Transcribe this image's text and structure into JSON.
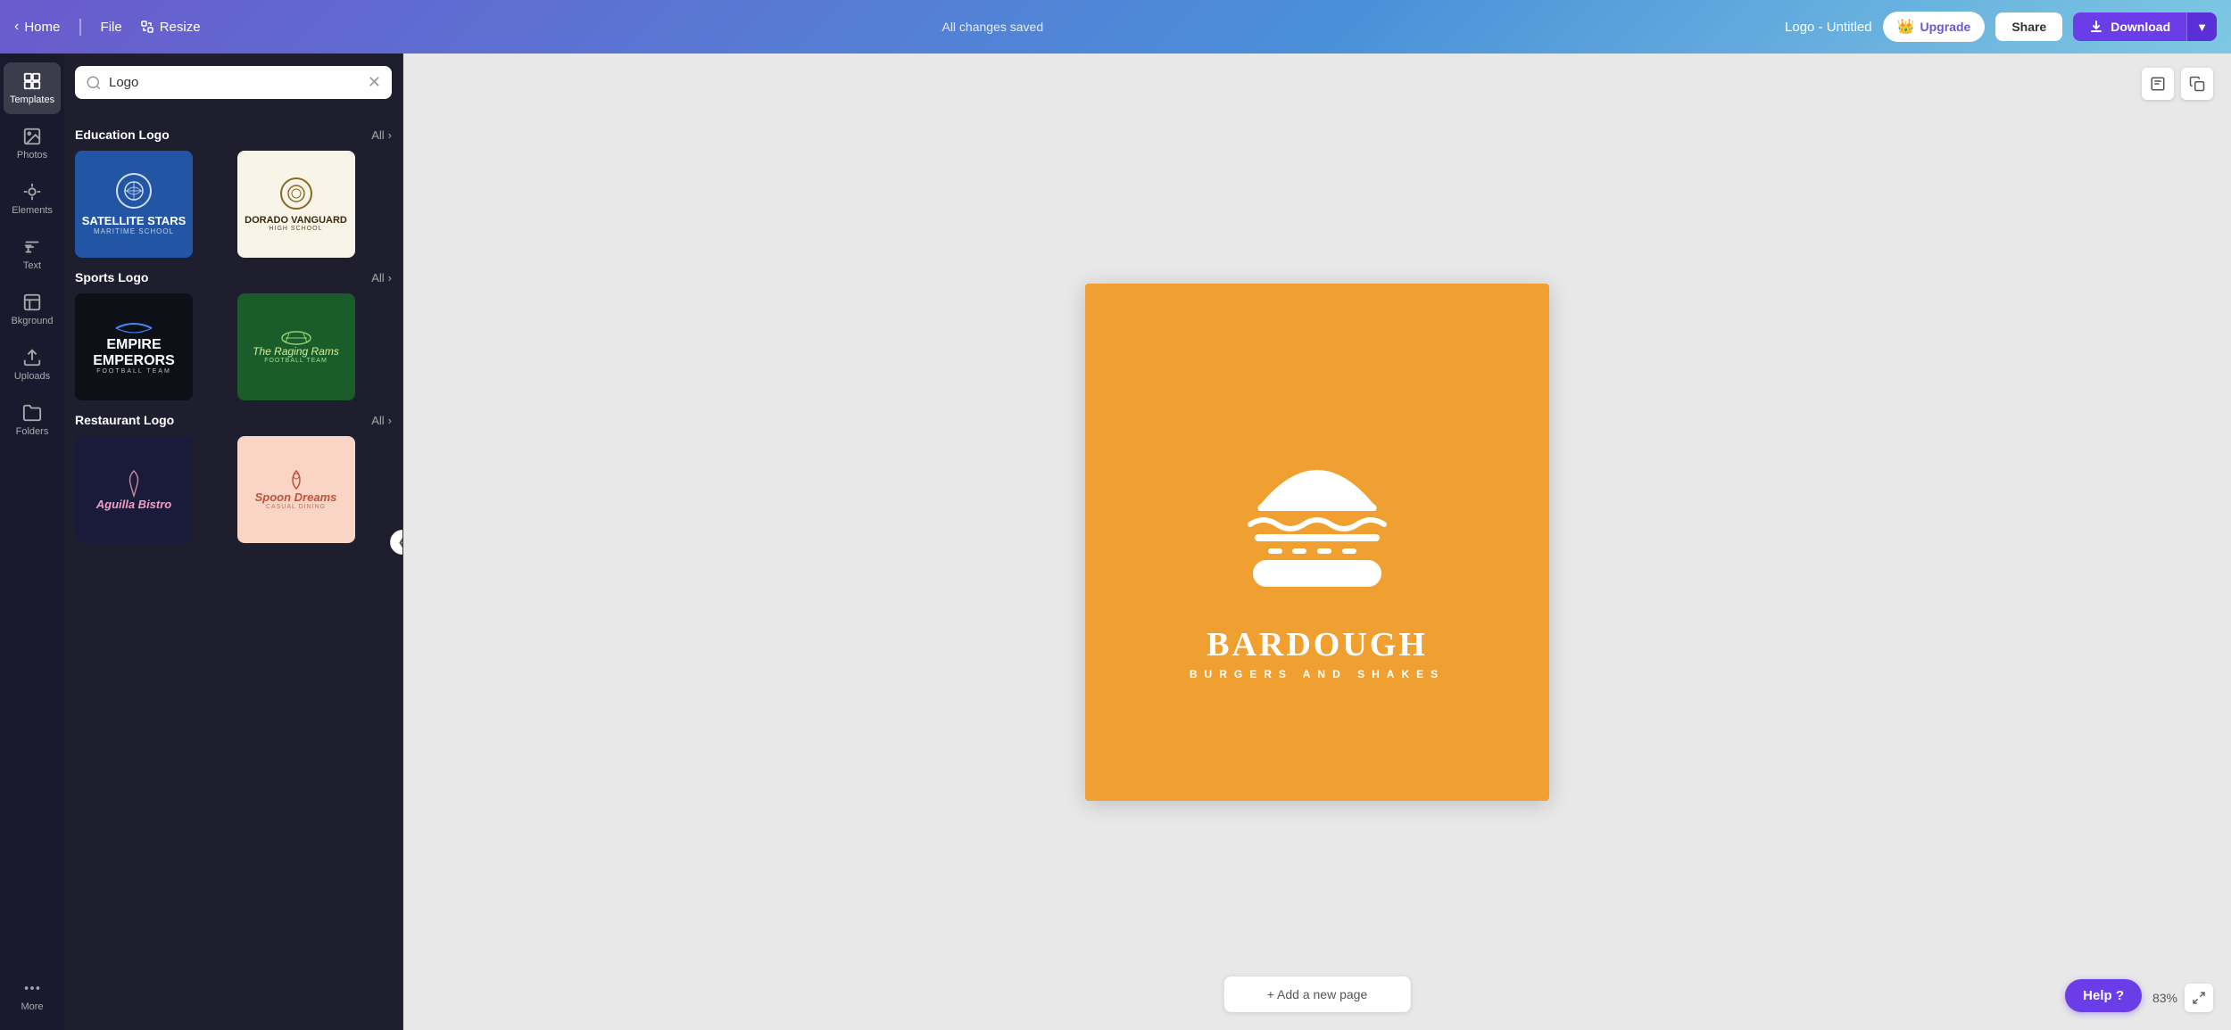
{
  "topbar": {
    "home_label": "Home",
    "file_label": "File",
    "resize_label": "Resize",
    "autosave_label": "All changes saved",
    "logo_title": "Logo - Untitled",
    "upgrade_label": "Upgrade",
    "share_label": "Share",
    "download_label": "Download"
  },
  "sidebar": {
    "items": [
      {
        "id": "templates",
        "label": "Templates",
        "icon": "grid-icon"
      },
      {
        "id": "photos",
        "label": "Photos",
        "icon": "photo-icon"
      },
      {
        "id": "elements",
        "label": "Elements",
        "icon": "elements-icon"
      },
      {
        "id": "text",
        "label": "Text",
        "icon": "text-icon"
      },
      {
        "id": "background",
        "label": "Bkground",
        "icon": "background-icon"
      },
      {
        "id": "uploads",
        "label": "Uploads",
        "icon": "upload-icon"
      },
      {
        "id": "folders",
        "label": "Folders",
        "icon": "folder-icon"
      },
      {
        "id": "more",
        "label": "More",
        "icon": "more-icon"
      }
    ]
  },
  "templates_panel": {
    "search_placeholder": "Logo",
    "sections": [
      {
        "id": "education-logo",
        "title": "Education Logo",
        "all_label": "All",
        "templates": [
          {
            "id": "edu-1",
            "name": "Satellite Stars",
            "sub": "Maritime School",
            "style": "blue"
          },
          {
            "id": "edu-2",
            "name": "Dorado Vanguard",
            "sub": "High School",
            "style": "cream"
          }
        ]
      },
      {
        "id": "sports-logo",
        "title": "Sports Logo",
        "all_label": "All",
        "templates": [
          {
            "id": "sports-1",
            "name": "Empire Emperors",
            "sub": "Football Team",
            "style": "dark"
          },
          {
            "id": "sports-2",
            "name": "The Raging Rams",
            "sub": "Football Team",
            "style": "green"
          }
        ]
      },
      {
        "id": "restaurant-logo",
        "title": "Restaurant Logo",
        "all_label": "All",
        "templates": [
          {
            "id": "rest-1",
            "name": "Aguilla Bistro",
            "sub": "",
            "style": "navy"
          },
          {
            "id": "rest-2",
            "name": "Spoon Dreams",
            "sub": "Casual Dining",
            "style": "peach"
          }
        ]
      }
    ]
  },
  "canvas": {
    "brand_name": "BARDOUGH",
    "brand_sub": "BURGERS AND SHAKES",
    "add_page_label": "+ Add a new page",
    "zoom_label": "83%"
  },
  "help": {
    "label": "Help ?"
  }
}
